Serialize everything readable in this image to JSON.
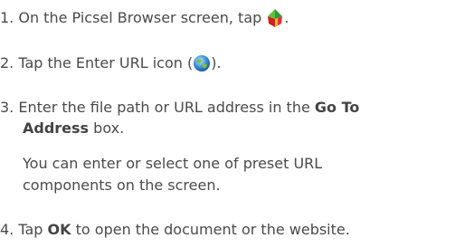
{
  "steps": [
    {
      "number": "1.",
      "text_before": "On the Picsel Browser screen, tap",
      "icon": "picsel-browser-icon",
      "text_after": "."
    },
    {
      "number": "2.",
      "text_before": "Tap the Enter URL icon (",
      "icon": "enter-url-globe-icon",
      "text_after": ")."
    },
    {
      "number": "3.",
      "line1_before": "Enter the file path or URL address in the",
      "bold1": "Go To",
      "bold2": "Address",
      "line2_after": "box.",
      "note_line1": "You can enter or select one of preset URL",
      "note_line2": "components on the screen."
    },
    {
      "number": "4.",
      "text_before": "Tap",
      "bold": "OK",
      "text_after": "to open the document or the website."
    }
  ],
  "colors": {
    "text": "#4a4a4a"
  }
}
